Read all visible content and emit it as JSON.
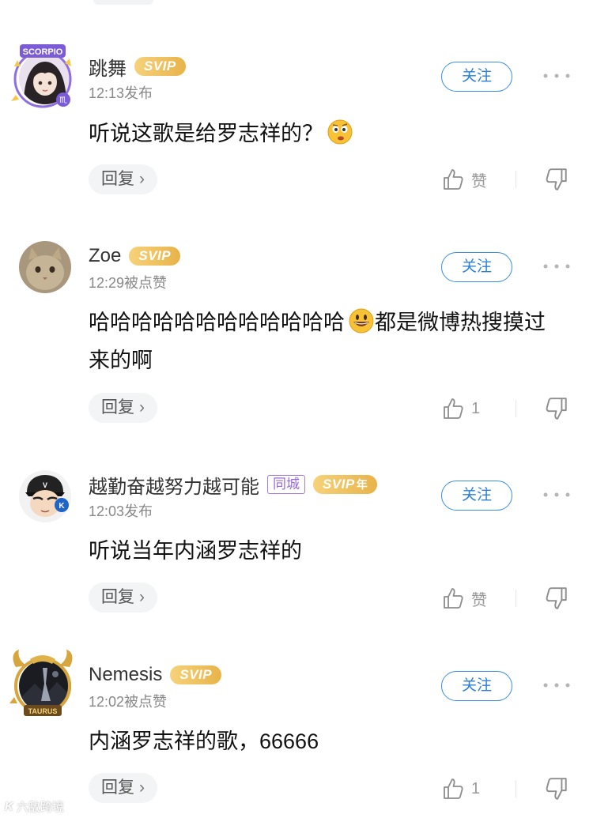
{
  "comments": [
    {
      "username": "跳舞",
      "badge": "SVIP",
      "city_tag": "",
      "badge_year": "",
      "meta": "12:13发布",
      "follow_label": "关注",
      "content": "听说这歌是给罗志祥的？",
      "content_emoji": "thinking-emoji",
      "reply_label": "回复",
      "like_label": "赞",
      "avatar_frame": "SCORPIO",
      "avatar_frame_icon": "scorpio-icon"
    },
    {
      "username": "Zoe",
      "badge": "SVIP",
      "city_tag": "",
      "badge_year": "",
      "meta": "12:29被点赞",
      "follow_label": "关注",
      "content_part1": "哈哈哈哈哈哈哈哈哈哈哈哈",
      "content_part2": "都是微博热搜摸过来的啊",
      "content_emoji": "grinning-emoji",
      "reply_label": "回复",
      "like_label": "1"
    },
    {
      "username": "越勤奋越努力越可能",
      "badge": "SVIP",
      "city_tag": "同城",
      "badge_year": "年",
      "meta": "12:03发布",
      "follow_label": "关注",
      "content": "听说当年内涵罗志祥的",
      "reply_label": "回复",
      "like_label": "赞"
    },
    {
      "username": "Nemesis",
      "badge": "SVIP",
      "city_tag": "",
      "badge_year": "",
      "meta": "12:02被点赞",
      "follow_label": "关注",
      "content": "内涵罗志祥的歌，66666",
      "reply_label": "回复",
      "like_label": "1",
      "avatar_frame": "TAURUS"
    }
  ],
  "watermark": {
    "logo": "K",
    "text": "六敌跨境"
  },
  "colors": {
    "follow_blue": "#2b7fd6",
    "svip_gold": "#e8b34a",
    "city_purple": "#9a6ad4",
    "muted_gray": "#888888"
  }
}
